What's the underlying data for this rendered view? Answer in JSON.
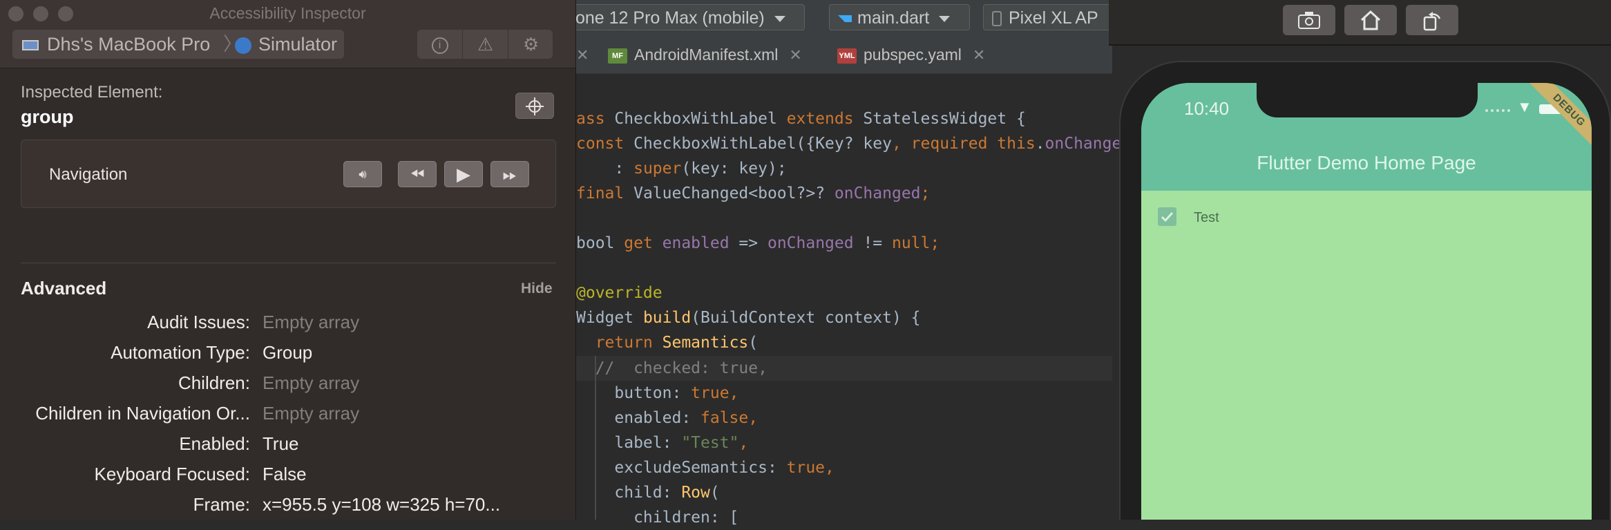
{
  "ide": {
    "toolbar": {
      "device_selector": "one 12 Pro Max (mobile)",
      "run_config": "main.dart",
      "emulator": "Pixel XL AP"
    },
    "tabs": [
      {
        "label": "AndroidManifest.xml",
        "icon": "MF"
      },
      {
        "label": "pubspec.yaml",
        "icon": "YML"
      }
    ],
    "code": [
      [
        "ass ",
        "CheckboxWithLabel",
        " extends ",
        "StatelessWidget",
        " {"
      ],
      [
        "const ",
        "CheckboxWithLabel({Key? key",
        ", ",
        "required ",
        "this",
        ".",
        "onChange"
      ],
      [
        "    : ",
        "super",
        "(key: key);"
      ],
      [
        "final ",
        "ValueChanged<bool?>? ",
        "onChanged",
        ";"
      ],
      [
        "bool ",
        "get ",
        "enabled",
        " => ",
        "onChanged",
        " != ",
        "null",
        ";"
      ],
      [
        "@override"
      ],
      [
        "Widget ",
        "build",
        "(BuildContext context) {"
      ],
      [
        "  ",
        "return ",
        "Semantics",
        "("
      ],
      [
        "  //  checked: true,"
      ],
      [
        "    button: ",
        "true",
        ","
      ],
      [
        "    enabled: ",
        "false",
        ","
      ],
      [
        "    label: ",
        "\"Test\"",
        ","
      ],
      [
        "    excludeSemantics: ",
        "true",
        ","
      ],
      [
        "    child: ",
        "Row",
        "("
      ],
      [
        "      children: ["
      ]
    ]
  },
  "inspector": {
    "window_title": "Accessibility Inspector",
    "path": {
      "device": "Dhs's MacBook Pro",
      "separator": "〉",
      "app": "Simulator"
    },
    "actions": [
      "info-icon",
      "warning-icon",
      "gear-icon"
    ],
    "inspected_label": "Inspected Element:",
    "inspected_value": "group",
    "navigation_label": "Navigation",
    "advanced_title": "Advanced",
    "hide_label": "Hide",
    "properties": [
      {
        "key": "Audit Issues:",
        "value": "Empty array",
        "muted": true
      },
      {
        "key": "Automation Type:",
        "value": "Group",
        "muted": false
      },
      {
        "key": "Children:",
        "value": "Empty array",
        "muted": true
      },
      {
        "key": "Children in Navigation Or...",
        "value": "Empty array",
        "muted": true
      },
      {
        "key": "Enabled:",
        "value": "True",
        "muted": false
      },
      {
        "key": "Keyboard Focused:",
        "value": "False",
        "muted": false
      },
      {
        "key": "Frame:",
        "value": "x=955.5 y=108 w=325 h=70...",
        "muted": false
      }
    ]
  },
  "simulator": {
    "buttons": [
      "camera-icon",
      "home-icon",
      "rotate-icon"
    ],
    "status_time": "10:40",
    "app_title": "Flutter Demo Home Page",
    "debug_banner": "DEBUG",
    "checkbox_label": "Test",
    "checkbox_checked": true
  }
}
